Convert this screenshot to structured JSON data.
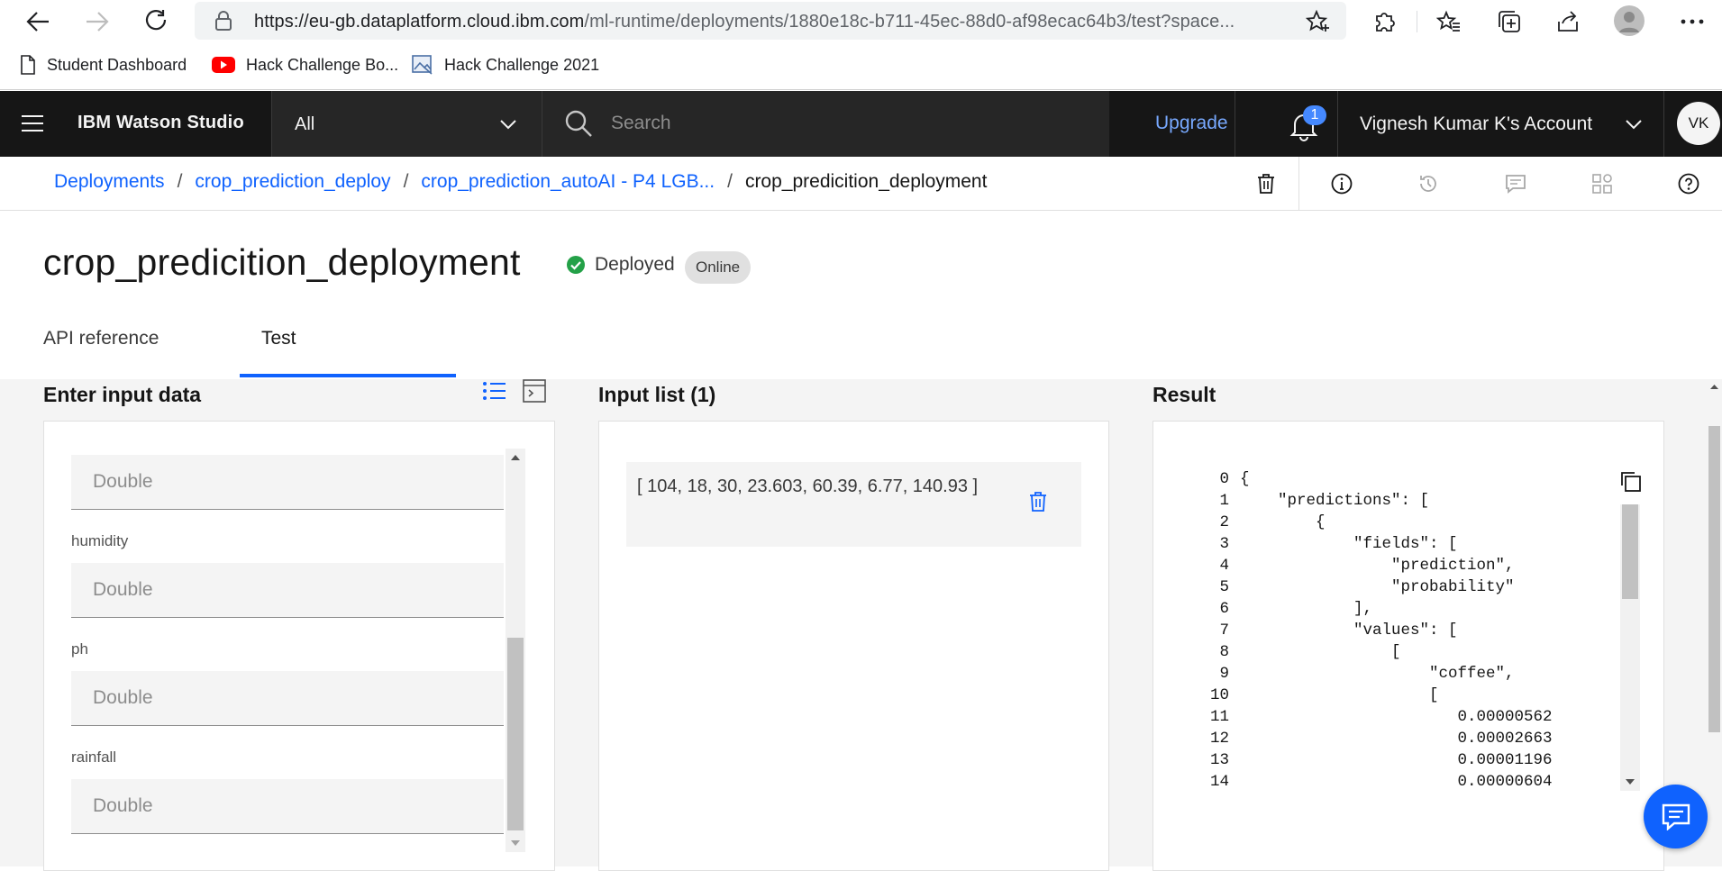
{
  "browser": {
    "url_main": "https://eu-gb.dataplatform.cloud.ibm.com",
    "url_rest": "/ml-runtime/deployments/1880e18c-b711-45ec-88d0-af98ecac64b3/test?space...",
    "bookmarks": [
      "Student Dashboard",
      "Hack Challenge Bo...",
      "Hack Challenge 2021"
    ]
  },
  "header": {
    "product": "IBM Watson Studio",
    "scope": "All",
    "search_placeholder": "Search",
    "upgrade": "Upgrade",
    "notification_count": "1",
    "account": "Vignesh Kumar K's Account",
    "avatar": "VK"
  },
  "breadcrumb": {
    "items": [
      "Deployments",
      "crop_prediction_deploy",
      "crop_prediction_autoAI - P4 LGB..."
    ],
    "current": "crop_predicition_deployment"
  },
  "page": {
    "title": "crop_predicition_deployment",
    "status": "Deployed",
    "tag": "Online"
  },
  "tabs": {
    "api": "API reference",
    "test": "Test"
  },
  "input_panel": {
    "title": "Enter input data",
    "fields": [
      {
        "label": "",
        "placeholder": "Double"
      },
      {
        "label": "humidity",
        "placeholder": "Double"
      },
      {
        "label": "ph",
        "placeholder": "Double"
      },
      {
        "label": "rainfall",
        "placeholder": "Double"
      }
    ]
  },
  "input_list": {
    "title": "Input list (1)",
    "items": [
      "[ 104, 18, 30, 23.603, 60.39, 6.77, 140.93 ]"
    ]
  },
  "result": {
    "title": "Result",
    "lines": [
      {
        "n": "0",
        "text": "{"
      },
      {
        "n": "1",
        "text": "    \"predictions\": ["
      },
      {
        "n": "2",
        "text": "        {"
      },
      {
        "n": "3",
        "text": "            \"fields\": ["
      },
      {
        "n": "4",
        "text": "                \"prediction\","
      },
      {
        "n": "5",
        "text": "                \"probability\""
      },
      {
        "n": "6",
        "text": "            ],"
      },
      {
        "n": "7",
        "text": "            \"values\": ["
      },
      {
        "n": "8",
        "text": "                ["
      },
      {
        "n": "9",
        "text": "                    \"coffee\","
      },
      {
        "n": "10",
        "text": "                    ["
      },
      {
        "n": "11",
        "text": "                       0.00000562"
      },
      {
        "n": "12",
        "text": "                       0.00002663"
      },
      {
        "n": "13",
        "text": "                       0.00001196"
      },
      {
        "n": "14",
        "text": "                       0.00000604"
      }
    ]
  },
  "colors": {
    "ibm_blue": "#0f62fe",
    "header_bg": "#161616",
    "success_green": "#24a148"
  }
}
